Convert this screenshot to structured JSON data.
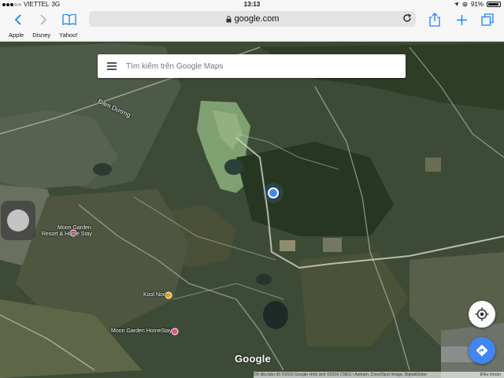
{
  "status_bar": {
    "carrier": "VIETTEL",
    "network": "3G",
    "time": "13:13",
    "battery_percent": 91,
    "battery_text": "91%"
  },
  "browser": {
    "url": "google.com",
    "bookmarks": [
      "Apple",
      "Disney",
      "Yahoo!"
    ]
  },
  "search": {
    "placeholder": "Tìm kiếm trên Google Maps"
  },
  "map_labels": {
    "dam_duong": "Đầm Dương",
    "moon_garden_resort_1": "Moon Garden",
    "moon_garden_resort_2": "Resort & Home Stay",
    "kool_noo": "Kool Noo",
    "moon_garden_homestay": "Moon Garden HomeStay"
  },
  "footer": {
    "logo": "Google",
    "attribution": "Dữ liệu bản đồ ©2016 Google Hình ảnh ©2016 CNES / Astrium, Cnes/Spot Image, DigitalGlobe",
    "terms": "Điều khoản"
  },
  "colors": {
    "accent_blue": "#4285f4",
    "ios_blue": "#1a82fb",
    "poi_pink": "#e64a8c",
    "poi_orange": "#f0a020"
  }
}
